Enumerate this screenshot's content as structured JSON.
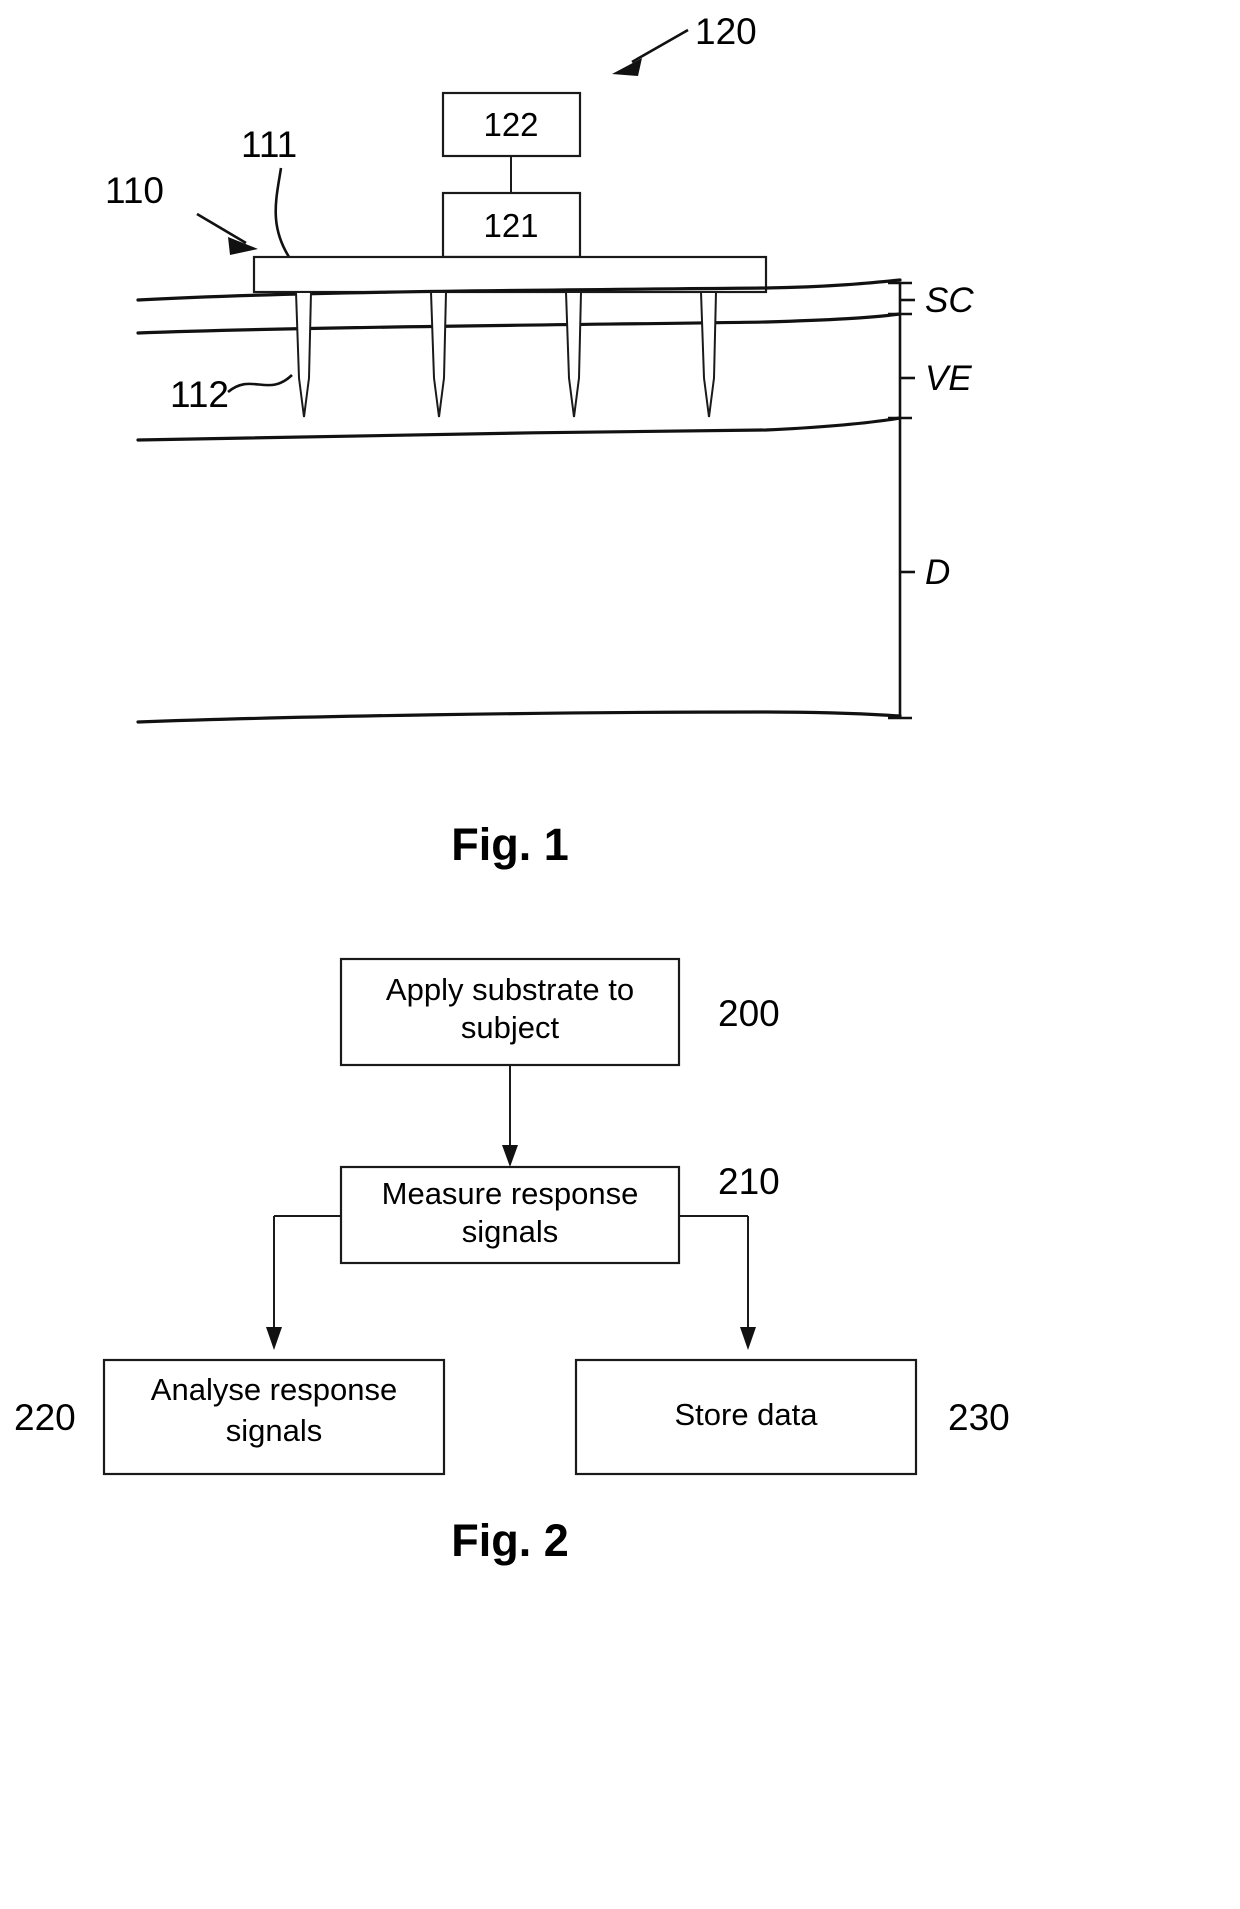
{
  "document": {
    "type": "patent-figure-sheet",
    "background_color": "#ffffff",
    "line_color": "#111111"
  },
  "figure1": {
    "caption": "Fig. 1",
    "reference_numerals": {
      "device_assembly": "120",
      "substrate_assembly": "110",
      "substrate": "111",
      "microneedle": "112",
      "unit_lower": "121",
      "unit_upper": "122"
    },
    "boxes": [
      {
        "id": "box-122",
        "label": "122"
      },
      {
        "id": "box-121",
        "label": "121"
      }
    ],
    "skin_layers": [
      {
        "code": "SC",
        "name": "SC"
      },
      {
        "code": "VE",
        "name": "VE"
      },
      {
        "code": "D",
        "name": "D"
      }
    ],
    "microneedle_count": 4
  },
  "figure2": {
    "caption": "Fig. 2",
    "steps": [
      {
        "id": "step-200",
        "text": "Apply substrate to subject",
        "ref": "200",
        "ref_side": "right"
      },
      {
        "id": "step-210",
        "text": "Measure response signals",
        "ref": "210",
        "ref_side": "right"
      },
      {
        "id": "step-220",
        "text": "Analyse response signals",
        "ref": "220",
        "ref_side": "left"
      },
      {
        "id": "step-230",
        "text": "Store data",
        "ref": "230",
        "ref_side": "right"
      }
    ]
  }
}
